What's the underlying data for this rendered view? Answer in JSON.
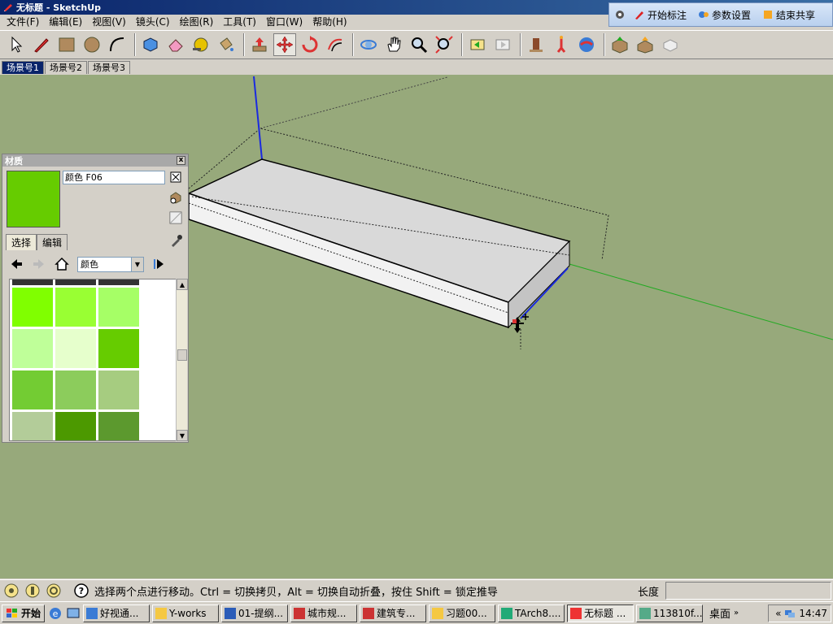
{
  "window": {
    "title": "无标题 - SketchUp"
  },
  "menu": [
    "文件(F)",
    "编辑(E)",
    "视图(V)",
    "镜头(C)",
    "绘图(R)",
    "工具(T)",
    "窗口(W)",
    "帮助(H)"
  ],
  "share_panel": {
    "start_markup": "开始标注",
    "params": "参数设置",
    "end_share": "结束共享"
  },
  "toolbar_icons": [
    "select-icon",
    "pencil-icon",
    "rectangle-icon",
    "circle-icon",
    "arc-icon",
    "make-component-icon",
    "eraser-icon",
    "tape-measure-icon",
    "paint-bucket-icon",
    "push-pull-icon",
    "move-icon",
    "rotate-icon",
    "offset-icon",
    "orbit-icon",
    "pan-icon",
    "zoom-icon",
    "zoom-extents-icon",
    "previous-view-icon",
    "next-view-icon",
    "position-camera-icon",
    "walk-icon",
    "look-around-icon",
    "section-icon",
    "get-models-icon",
    "share-model-icon"
  ],
  "scenes": [
    "场景号1",
    "场景号2",
    "场景号3"
  ],
  "materials": {
    "title": "材质",
    "close": "x",
    "name": "颜色 F06",
    "preview_color": "#66cc00",
    "tabs": [
      "选择",
      "编辑"
    ],
    "library": "颜色",
    "swatches": [
      "#80ff00",
      "#99ff33",
      "#a6ff66",
      "#bfff99",
      "#e6ffcc",
      "#66cc00",
      "#73cc33",
      "#8ccc5c",
      "#a6cc80",
      "#b3cc99",
      "#4c9900",
      "#5c992e"
    ]
  },
  "status": {
    "hint": "选择两个点进行移动。Ctrl = 切换拷贝，Alt = 切换自动折叠，按住 Shift = 锁定推导",
    "measure_label": "长度",
    "measure_value": ""
  },
  "taskbar": {
    "start": "开始",
    "tasks": [
      {
        "label": "好视通...",
        "icon": "video-conf-icon",
        "active": false
      },
      {
        "label": "Y-works",
        "icon": "folder-icon",
        "active": false
      },
      {
        "label": "01-提纲...",
        "icon": "word-doc-icon",
        "active": false
      },
      {
        "label": "城市规...",
        "icon": "cad-icon",
        "active": false
      },
      {
        "label": "建筑专...",
        "icon": "cad-icon",
        "active": false
      },
      {
        "label": "习题00...",
        "icon": "folder-icon",
        "active": false
      },
      {
        "label": "TArch8....",
        "icon": "tarch-icon",
        "active": false
      },
      {
        "label": "无标题 ...",
        "icon": "sketchup-icon",
        "active": true
      },
      {
        "label": "113810f...",
        "icon": "image-icon",
        "active": false
      }
    ],
    "desktop": "桌面",
    "clock": "14:47"
  }
}
